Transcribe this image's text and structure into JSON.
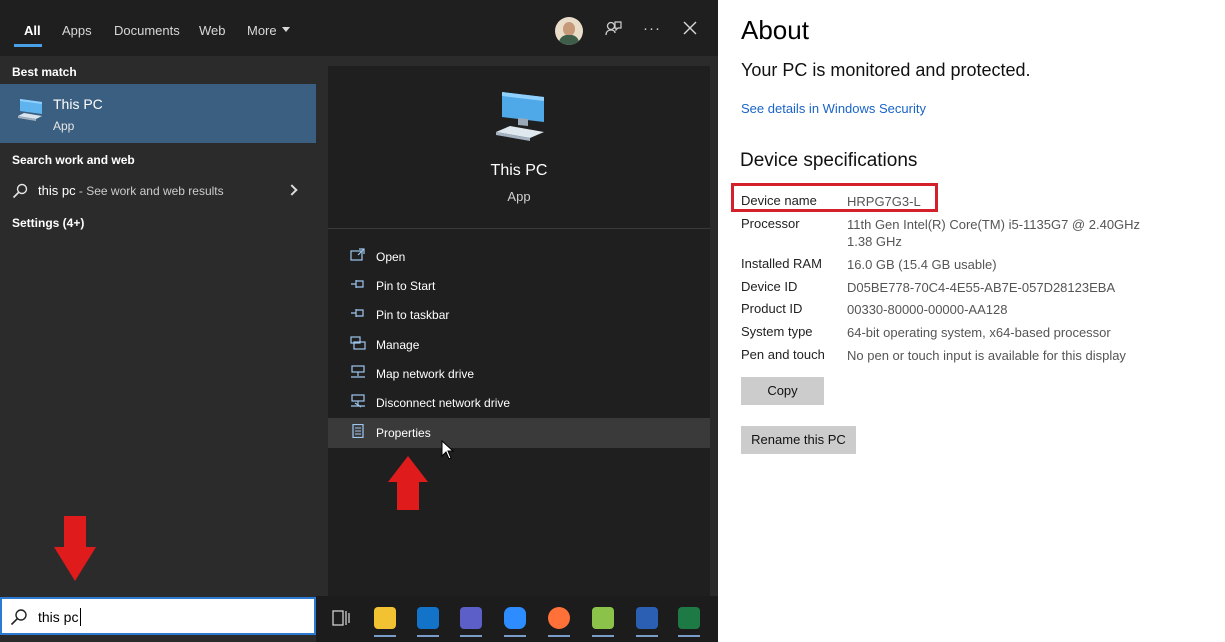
{
  "start_menu": {
    "tabs": [
      {
        "label": "All",
        "active": true
      },
      {
        "label": "Apps",
        "active": false
      },
      {
        "label": "Documents",
        "active": false
      },
      {
        "label": "Web",
        "active": false
      },
      {
        "label": "More",
        "active": false
      }
    ],
    "top_icons": [
      "avatar",
      "feedback-icon",
      "ellipsis-icon",
      "close-icon"
    ],
    "ellipsis": "···",
    "best_match_heading": "Best match",
    "best_match": {
      "title": "This PC",
      "subtitle": "App",
      "icon": "computer-icon"
    },
    "search_web_heading": "Search work and web",
    "web_result": {
      "query": "this pc",
      "suffix": " - See work and web results"
    },
    "settings_heading": "Settings (4+)",
    "preview": {
      "title": "This PC",
      "subtitle": "App",
      "actions": [
        {
          "label": "Open",
          "icon": "open-icon"
        },
        {
          "label": "Pin to Start",
          "icon": "pin-icon"
        },
        {
          "label": "Pin to taskbar",
          "icon": "pin-icon"
        },
        {
          "label": "Manage",
          "icon": "manage-icon"
        },
        {
          "label": "Map network drive",
          "icon": "network-drive-icon"
        },
        {
          "label": "Disconnect network drive",
          "icon": "disconnect-drive-icon"
        },
        {
          "label": "Properties",
          "icon": "properties-icon",
          "highlighted": true
        }
      ]
    },
    "search_box": {
      "value": "this pc"
    }
  },
  "taskbar": {
    "icons": [
      "task-view-icon",
      "file-explorer-icon",
      "outlook-icon",
      "teams-icon",
      "zoom-icon",
      "firefox-icon",
      "notepad-plus-icon",
      "word-icon",
      "excel-icon"
    ],
    "colors": {
      "file_explorer": "#f2c233",
      "outlook": "#1273c9",
      "teams": "#5b5fc7",
      "zoom": "#2d8cff",
      "firefox": "#ff7139",
      "notepad": "#8bc34a",
      "word": "#2b5fb4",
      "excel": "#1e7a45"
    }
  },
  "about": {
    "title": "About",
    "protection": "Your PC is monitored and protected.",
    "security_link": "See details in Windows Security",
    "spec_heading": "Device specifications",
    "specs": [
      {
        "label": "Device name",
        "value": "HRPG7G3-L"
      },
      {
        "label": "Processor",
        "value": "11th Gen Intel(R) Core(TM) i5-1135G7 @ 2.40GHz   1.38 GHz"
      },
      {
        "label": "Installed RAM",
        "value": "16.0 GB (15.4 GB usable)"
      },
      {
        "label": "Device ID",
        "value": "D05BE778-70C4-4E55-AB7E-057D28123EBA"
      },
      {
        "label": "Product ID",
        "value": "00330-80000-00000-AA128"
      },
      {
        "label": "System type",
        "value": "64-bit operating system, x64-based processor"
      },
      {
        "label": "Pen and touch",
        "value": "No pen or touch input is available for this display"
      }
    ],
    "copy_button": "Copy",
    "rename_button": "Rename this PC"
  },
  "colors": {
    "accent": "#4aa0e6",
    "selected_bg": "#3b5f80",
    "annotation_red": "#d3202a",
    "link": "#1a64c8"
  }
}
